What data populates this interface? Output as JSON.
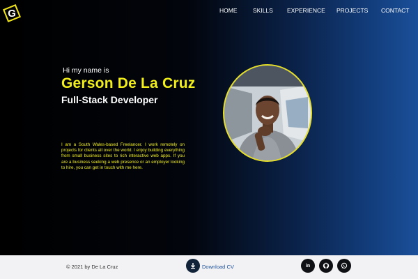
{
  "header": {
    "logo_letter": "G",
    "nav": [
      "HOME",
      "SKILLS",
      "EXPERIENCE",
      "PROJECTS",
      "CONTACT"
    ]
  },
  "hero": {
    "greeting": "Hi my name is",
    "name": "Gerson De La Cruz",
    "role": "Full-Stack Developer",
    "bio": "I am a South Wales-based Freelancer. I work remotely on projects for clients all over the world. I enjoy building everything from small business sites to rich interactive web apps. If you are a business seeking a web presence or an employer looking to hire, you can get in touch with me here."
  },
  "footer": {
    "copyright": "© 2021 by De La Cruz",
    "download_label": "Download CV",
    "social": [
      {
        "icon": "linkedin-icon",
        "glyph": "in"
      },
      {
        "icon": "github-icon",
        "glyph": ""
      },
      {
        "icon": "whatsapp-icon",
        "glyph": ""
      }
    ]
  },
  "colors": {
    "accent": "#f1ee1b",
    "background": "#000000",
    "gradient_end": "#1a4f99",
    "footer_bg": "#f2f2f4"
  }
}
